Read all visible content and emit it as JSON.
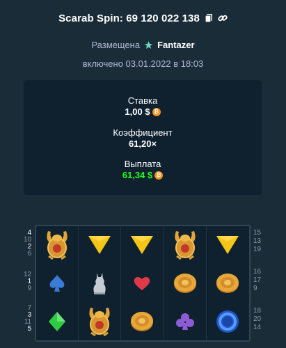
{
  "header": {
    "title": "Scarab Spin: 69 120 022 138",
    "copy_icon": "copy-icon",
    "link_icon": "link-icon"
  },
  "meta": {
    "placed_label": "Размещена",
    "user": "Fantazer",
    "rank_icon": "rank-star-icon",
    "date_text": "включено 03.01.2022 в 18:03"
  },
  "stats": {
    "bet_label": "Ставка",
    "bet_value": "1,00 $",
    "multiplier_label": "Коэффициент",
    "multiplier_value": "61,20×",
    "payout_label": "Выплата",
    "payout_value": "61,34 $",
    "currency_icon": "bitcoin-icon",
    "currency_color": "#f7931a",
    "payout_color": "#1fff20"
  },
  "board": {
    "symbols": [
      [
        "scarab",
        "triangle",
        "triangle",
        "scarab",
        "triangle"
      ],
      [
        "spade",
        "cat-statue",
        "heart",
        "coin-disc",
        "coin-disc"
      ],
      [
        "diamond",
        "scarab",
        "coin-disc",
        "club",
        "blue-ring"
      ]
    ],
    "left_lines": [
      [
        "4"
      ],
      [
        "10",
        "2",
        "6"
      ],
      [
        "12"
      ],
      [
        "1"
      ],
      [
        "9"
      ],
      [
        "7"
      ],
      [
        "3"
      ],
      [
        "11"
      ],
      [
        "5"
      ]
    ],
    "right_lines": [
      "15",
      "13",
      "19",
      "16",
      "17",
      "9",
      "18",
      "20",
      "14"
    ]
  }
}
